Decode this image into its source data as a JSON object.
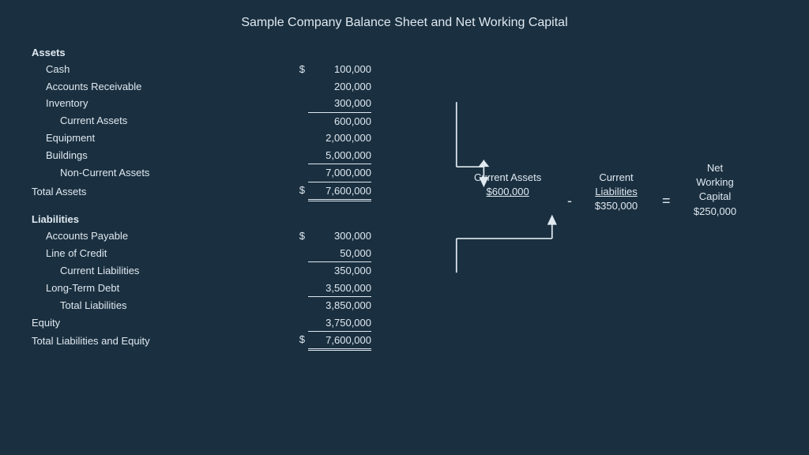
{
  "title": "Sample Company Balance Sheet and Net Working Capital",
  "assets": {
    "header": "Assets",
    "items": [
      {
        "label": "Cash",
        "dollar": "$",
        "amount": "100,000",
        "indent": 1
      },
      {
        "label": "Accounts Receivable",
        "dollar": "",
        "amount": "200,000",
        "indent": 1
      },
      {
        "label": "Inventory",
        "dollar": "",
        "amount": "300,000",
        "indent": 1
      },
      {
        "label": "Current Assets",
        "dollar": "",
        "amount": "600,000",
        "indent": 2,
        "style": "subtotal"
      },
      {
        "label": "Equipment",
        "dollar": "",
        "amount": "2,000,000",
        "indent": 1
      },
      {
        "label": "Buildings",
        "dollar": "",
        "amount": "5,000,000",
        "indent": 1
      },
      {
        "label": "Non-Current Assets",
        "dollar": "",
        "amount": "7,000,000",
        "indent": 2,
        "style": "subtotal"
      },
      {
        "label": "Total Assets",
        "dollar": "$",
        "amount": "7,600,000",
        "indent": 0,
        "style": "total"
      }
    ]
  },
  "liabilities": {
    "header": "Liabilities",
    "items": [
      {
        "label": "Accounts Payable",
        "dollar": "$",
        "amount": "300,000",
        "indent": 1
      },
      {
        "label": "Line of Credit",
        "dollar": "",
        "amount": "50,000",
        "indent": 1
      },
      {
        "label": "Current Liabilities",
        "dollar": "",
        "amount": "350,000",
        "indent": 2,
        "style": "subtotal"
      },
      {
        "label": "Long-Term Debt",
        "dollar": "",
        "amount": "3,500,000",
        "indent": 1
      },
      {
        "label": "Total Liabilities",
        "dollar": "",
        "amount": "3,850,000",
        "indent": 2,
        "style": "subtotal"
      }
    ]
  },
  "equity": {
    "label": "Equity",
    "amount": "3,750,000"
  },
  "totalLiabEquity": {
    "label": "Total Liabilities and Equity",
    "dollar": "$",
    "amount": "7,600,000"
  },
  "diagram": {
    "currentAssets": {
      "label": "Current\nAssets",
      "value": "$600,000"
    },
    "currentLiabilities": {
      "label": "Current\nLiabilities",
      "value": "$350,000"
    },
    "netWorkingCapital": {
      "label": "Net\nWorking\nCapital",
      "value": "$250,000"
    },
    "minus": "-",
    "equals": "="
  }
}
